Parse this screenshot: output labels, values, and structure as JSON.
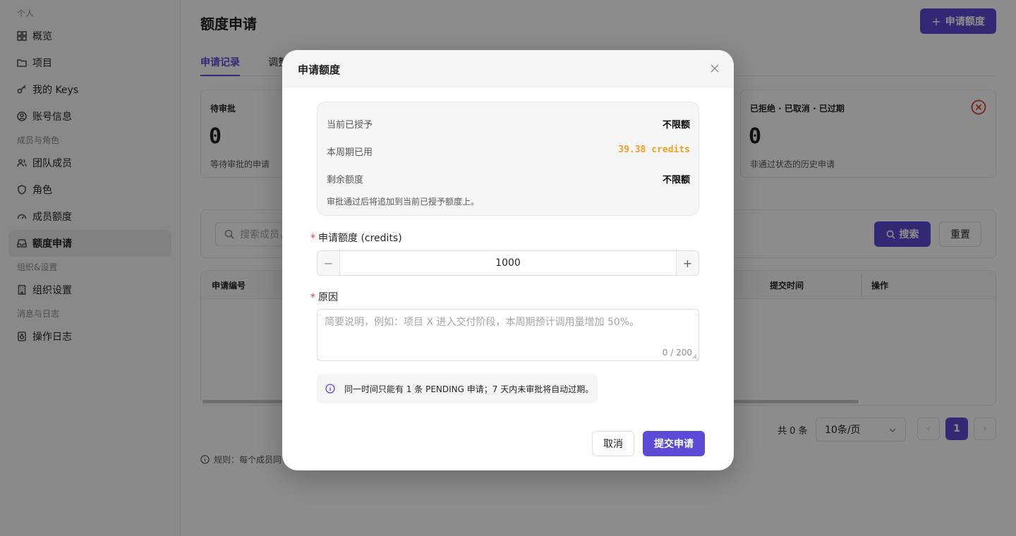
{
  "sidebar": {
    "groups": {
      "personal": "个人",
      "members": "成员与角色",
      "org": "组织&设置",
      "logs": "消息与日志"
    },
    "items": [
      {
        "label": "概览",
        "icon": "grid-icon"
      },
      {
        "label": "项目",
        "icon": "folder-icon"
      },
      {
        "label": "我的 Keys",
        "icon": "key-icon"
      },
      {
        "label": "账号信息",
        "icon": "user-circle-icon"
      },
      {
        "label": "团队成员",
        "icon": "users-icon"
      },
      {
        "label": "角色",
        "icon": "shield-icon"
      },
      {
        "label": "成员额度",
        "icon": "gauge-icon"
      },
      {
        "label": "额度申请",
        "icon": "inbox-icon",
        "active": true
      },
      {
        "label": "组织设置",
        "icon": "building-icon"
      },
      {
        "label": "操作日志",
        "icon": "log-icon"
      }
    ]
  },
  "main": {
    "title": "额度申请",
    "apply_button": "申请额度",
    "tabs": [
      "申请记录",
      "调整"
    ],
    "stats": [
      {
        "title": "待审批",
        "value": "0",
        "desc": "等待审批的申请"
      },
      {
        "title": "已拒绝 · 已取消 · 已过期",
        "value": "0",
        "desc": "非通过状态的历史申请"
      }
    ],
    "search": {
      "placeholder": "搜索成员，",
      "search_button": "搜索",
      "reset_button": "重置"
    },
    "table": {
      "headers": [
        "申请编号",
        "提交时间",
        "操作"
      ]
    },
    "pagination": {
      "total": "共 0 条",
      "page_size": "10条/页",
      "current_page": "1"
    },
    "rule_text": "规则：每个成员同"
  },
  "modal": {
    "title": "申请额度",
    "info": {
      "granted_label": "当前已授予",
      "granted_value": "不限额",
      "used_label": "本周期已用",
      "used_value": "39.38 credits",
      "remaining_label": "剩余额度",
      "remaining_value": "不限额",
      "note": "审批通过后将追加到当前已授予额度上。"
    },
    "amount": {
      "label": "申请额度 (credits)",
      "value": "1000"
    },
    "reason": {
      "label": "原因",
      "placeholder": "简要说明，例如：项目 X 进入交付阶段，本周期预计调用量增加 50%。",
      "counter": "0 / 200"
    },
    "notice": "同一时间只能有 1 条 PENDING 申请；7 天内未审批将自动过期。",
    "cancel_button": "取消",
    "submit_button": "提交申请"
  },
  "colors": {
    "accent": "#5b4bd6",
    "warning": "#f0a022",
    "danger": "#e53935"
  }
}
